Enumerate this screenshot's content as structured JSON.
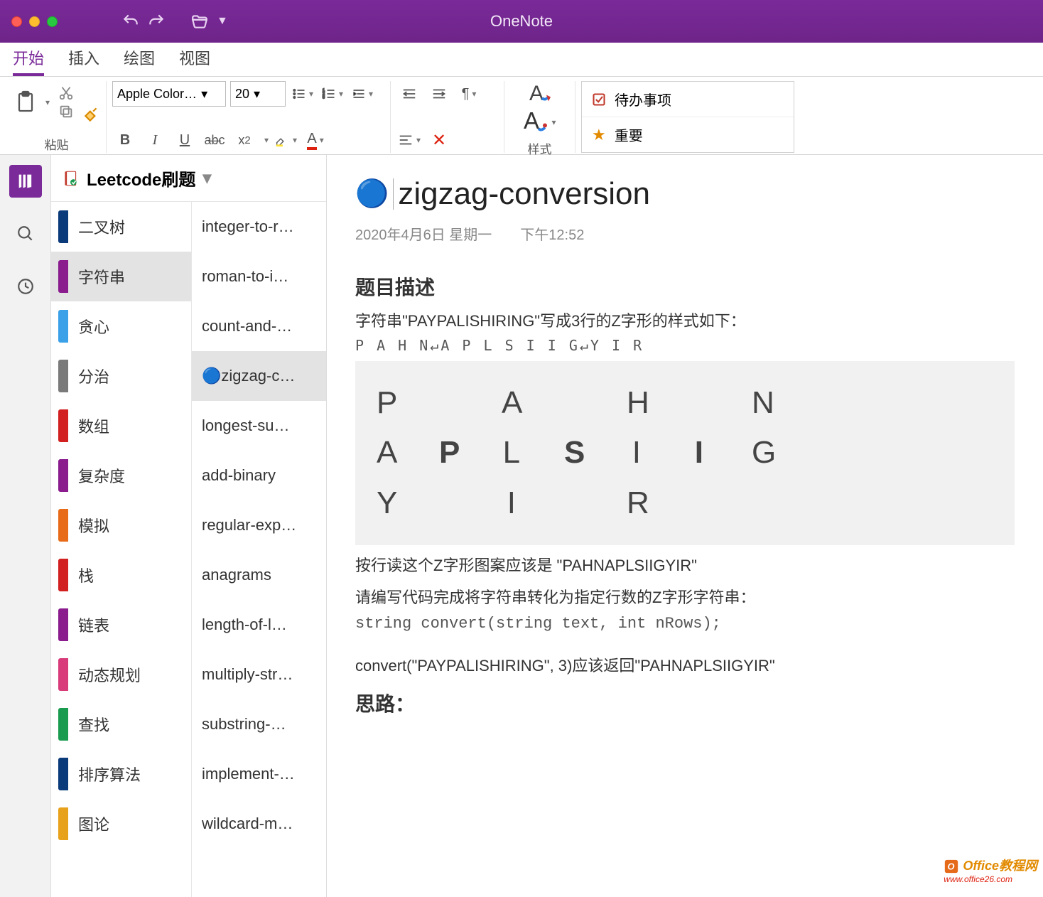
{
  "titlebar": {
    "appname": "OneNote"
  },
  "menu": {
    "tabs": [
      "开始",
      "插入",
      "绘图",
      "视图"
    ],
    "active": 0
  },
  "ribbon": {
    "paste_label": "粘贴",
    "font_name": "Apple Color…",
    "font_size": "20",
    "styles_label": "样式",
    "tags": [
      {
        "icon": "checkbox",
        "label": "待办事项"
      },
      {
        "icon": "star",
        "label": "重要"
      }
    ]
  },
  "notebook": {
    "name": "Leetcode刷题",
    "sections": [
      {
        "label": "二叉树",
        "color": "#0b3a7a"
      },
      {
        "label": "字符串",
        "color": "#8a1c8e",
        "selected": true
      },
      {
        "label": "贪心",
        "color": "#3aa0e8"
      },
      {
        "label": "分治",
        "color": "#7a7a7a"
      },
      {
        "label": "数组",
        "color": "#d21f1f"
      },
      {
        "label": "复杂度",
        "color": "#8a1c8e"
      },
      {
        "label": "模拟",
        "color": "#e86b1a"
      },
      {
        "label": "栈",
        "color": "#d21f1f"
      },
      {
        "label": "链表",
        "color": "#8a1c8e"
      },
      {
        "label": "动态规划",
        "color": "#d83a7a"
      },
      {
        "label": "查找",
        "color": "#1a9c50"
      },
      {
        "label": "排序算法",
        "color": "#0b3a7a"
      },
      {
        "label": "图论",
        "color": "#e8a11a"
      }
    ],
    "pages": [
      {
        "label": "integer-to-r…"
      },
      {
        "label": "roman-to-i…"
      },
      {
        "label": "count-and-…"
      },
      {
        "label": "🔵zigzag-c…",
        "selected": true
      },
      {
        "label": "longest-su…"
      },
      {
        "label": "add-binary"
      },
      {
        "label": "regular-exp…"
      },
      {
        "label": "anagrams"
      },
      {
        "label": "length-of-l…"
      },
      {
        "label": "multiply-str…"
      },
      {
        "label": "substring-…"
      },
      {
        "label": "implement-…"
      },
      {
        "label": "wildcard-m…"
      }
    ]
  },
  "page": {
    "title_icon": "🔵",
    "title": "zigzag-conversion",
    "date": "2020年4月6日 星期一",
    "time": "下午12:52",
    "h_desc": "题目描述",
    "p1": "字符串\"PAYPALISHIRING\"写成3行的Z字形的样式如下：",
    "mono1": "P  A  H  N↵A P L S I I G↵Y  I  R",
    "zig": {
      "r1": [
        "P",
        "",
        "A",
        "",
        "H",
        "",
        "N"
      ],
      "r2": [
        "A",
        "P",
        "L",
        "S",
        "I",
        "I",
        "G"
      ],
      "r3": [
        "Y",
        "",
        "I",
        "",
        "R",
        "",
        ""
      ]
    },
    "p2": "按行读这个Z字形图案应该是 \"PAHNAPLSIIGYIR\"",
    "p3": "请编写代码完成将字符串转化为指定行数的Z字形字符串：",
    "code1": "string convert(string text, int nRows);",
    "p4": "convert(\"PAYPALISHIRING\", 3)应该返回\"PAHNAPLSIIGYIR\"",
    "h_idea": "思路："
  },
  "watermark": {
    "line1": "Office教程网",
    "line2": "www.office26.com"
  }
}
